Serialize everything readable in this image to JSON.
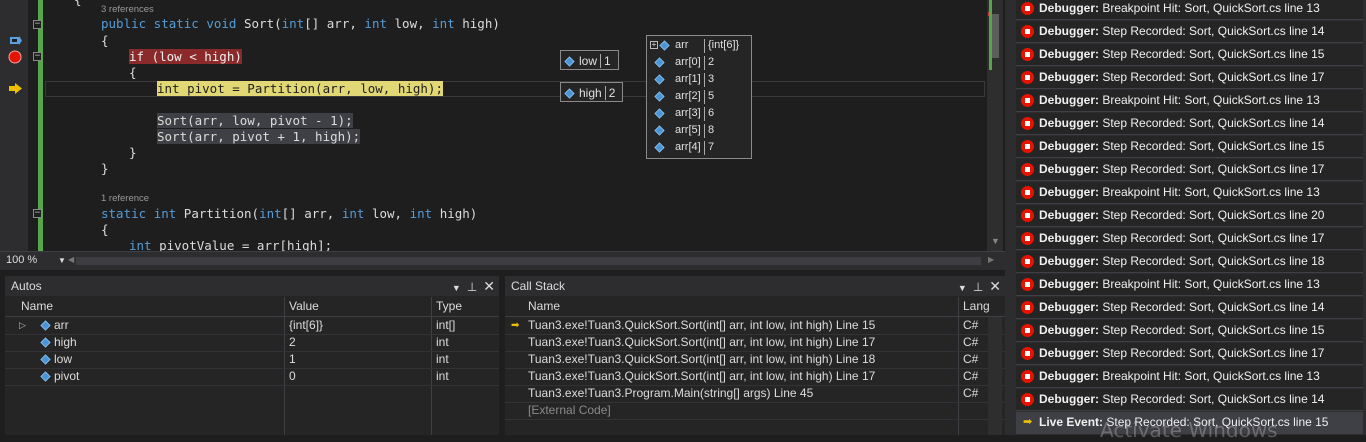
{
  "editor": {
    "lens1": "3 references",
    "lens2": "1 reference",
    "lines": {
      "top_brace": "{",
      "sig1_kw1": "public static void",
      "sig1_name": " Sort(",
      "sig1_kw2": "int",
      "sig1_rest1": "[] arr, ",
      "sig1_kw3": "int",
      "sig1_rest2": " low, ",
      "sig1_kw4": "int",
      "sig1_rest3": " high)",
      "open1": "{",
      "if_stmt": "if (low < high)",
      "open2": "{",
      "pivot_stmt": "int pivot = Partition(arr, low, high);",
      "sort_call1": "Sort(arr, low, pivot - 1);",
      "sort_call2": "Sort(arr, pivot + 1, high);",
      "close2": "}",
      "close1": "}",
      "sig2_kw1": "static",
      "sig2_kw2": "int",
      "sig2_name": " Partition(",
      "sig2_kw3": "int",
      "sig2_rest1": "[] arr, ",
      "sig2_kw4": "int",
      "sig2_rest2": " low, ",
      "sig2_kw5": "int",
      "sig2_rest3": " high)",
      "open3": "{",
      "pv_kw": "int",
      "pv_rest": " pivotValue = arr[high];"
    },
    "zoom": "100 %"
  },
  "datatips": {
    "low": {
      "name": "low",
      "value": "1"
    },
    "high": {
      "name": "high",
      "value": "2"
    },
    "arr": {
      "name": "arr",
      "value": "{int[6]}",
      "items": [
        {
          "name": "arr[0]",
          "value": "2"
        },
        {
          "name": "arr[1]",
          "value": "3"
        },
        {
          "name": "arr[2]",
          "value": "5"
        },
        {
          "name": "arr[3]",
          "value": "6"
        },
        {
          "name": "arr[5]",
          "value": "8"
        },
        {
          "name": "arr[4]",
          "value": "7"
        }
      ]
    }
  },
  "autos": {
    "title": "Autos",
    "headers": {
      "name": "Name",
      "value": "Value",
      "type": "Type"
    },
    "rows": [
      {
        "name": "arr",
        "value": "{int[6]}",
        "type": "int[]"
      },
      {
        "name": "high",
        "value": "2",
        "type": "int"
      },
      {
        "name": "low",
        "value": "1",
        "type": "int"
      },
      {
        "name": "pivot",
        "value": "0",
        "type": "int"
      }
    ]
  },
  "callstack": {
    "title": "Call Stack",
    "headers": {
      "name": "Name",
      "lang": "Lang"
    },
    "rows": [
      {
        "name": "Tuan3.exe!Tuan3.QuickSort.Sort(int[] arr, int low, int high) Line 15",
        "lang": "C#"
      },
      {
        "name": "Tuan3.exe!Tuan3.QuickSort.Sort(int[] arr, int low, int high) Line 17",
        "lang": "C#"
      },
      {
        "name": "Tuan3.exe!Tuan3.QuickSort.Sort(int[] arr, int low, int high) Line 18",
        "lang": "C#"
      },
      {
        "name": "Tuan3.exe!Tuan3.QuickSort.Sort(int[] arr, int low, int high) Line 17",
        "lang": "C#"
      },
      {
        "name": "Tuan3.exe!Tuan3.Program.Main(string[] args) Line 45",
        "lang": "C#"
      },
      {
        "name": "[External Code]",
        "lang": ""
      }
    ]
  },
  "events": [
    {
      "kind": "Debugger:",
      "text": " Breakpoint Hit: Sort, QuickSort.cs line 13"
    },
    {
      "kind": "Debugger:",
      "text": " Step Recorded: Sort, QuickSort.cs line 14"
    },
    {
      "kind": "Debugger:",
      "text": " Step Recorded: Sort, QuickSort.cs line 15"
    },
    {
      "kind": "Debugger:",
      "text": " Step Recorded: Sort, QuickSort.cs line 17"
    },
    {
      "kind": "Debugger:",
      "text": " Breakpoint Hit: Sort, QuickSort.cs line 13"
    },
    {
      "kind": "Debugger:",
      "text": " Step Recorded: Sort, QuickSort.cs line 14"
    },
    {
      "kind": "Debugger:",
      "text": " Step Recorded: Sort, QuickSort.cs line 15"
    },
    {
      "kind": "Debugger:",
      "text": " Step Recorded: Sort, QuickSort.cs line 17"
    },
    {
      "kind": "Debugger:",
      "text": " Breakpoint Hit: Sort, QuickSort.cs line 13"
    },
    {
      "kind": "Debugger:",
      "text": " Step Recorded: Sort, QuickSort.cs line 20"
    },
    {
      "kind": "Debugger:",
      "text": " Step Recorded: Sort, QuickSort.cs line 17"
    },
    {
      "kind": "Debugger:",
      "text": " Step Recorded: Sort, QuickSort.cs line 18"
    },
    {
      "kind": "Debugger:",
      "text": " Breakpoint Hit: Sort, QuickSort.cs line 13"
    },
    {
      "kind": "Debugger:",
      "text": " Step Recorded: Sort, QuickSort.cs line 14"
    },
    {
      "kind": "Debugger:",
      "text": " Step Recorded: Sort, QuickSort.cs line 15"
    },
    {
      "kind": "Debugger:",
      "text": " Step Recorded: Sort, QuickSort.cs line 17"
    },
    {
      "kind": "Debugger:",
      "text": " Breakpoint Hit: Sort, QuickSort.cs line 13"
    },
    {
      "kind": "Debugger:",
      "text": " Step Recorded: Sort, QuickSort.cs line 14"
    }
  ],
  "live_event": {
    "kind": "Live Event:",
    "text": " Step Recorded: Sort, QuickSort.cs line 15"
  },
  "watermark": "Activate Windows",
  "colors": {
    "accent_green": "#57a64a",
    "breakpoint_red": "#e51400",
    "keyword_blue": "#569cd6"
  }
}
